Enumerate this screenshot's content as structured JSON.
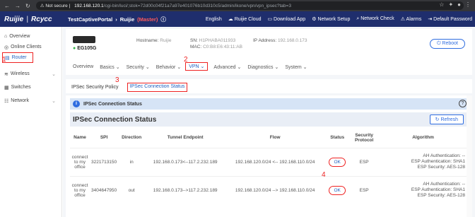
{
  "browser": {
    "not_secure": "Not secure",
    "host": "192.168.120.1",
    "path": "/cgi-bin/luci/;stok=72d00c04f21a7a97e401076b10d310c5/admin/ikone/vpn/vpn_ipsec?tab=3"
  },
  "header": {
    "logo_primary": "Ruijie",
    "logo_secondary": "Rcycc",
    "breadcrumb_portal": "TestCaptivePortal",
    "breadcrumb_device": "Ruijie",
    "breadcrumb_role": "(Master)",
    "links": [
      "English",
      "Ruijie Cloud",
      "Download App",
      "Network Setup",
      "Network Check",
      "Alarms",
      "Default Password"
    ]
  },
  "sidebar": {
    "items": [
      {
        "label": "Overview",
        "icon": "overview-icon"
      },
      {
        "label": "Online Clients",
        "icon": "clients-icon"
      },
      {
        "label": "Router",
        "icon": "router-icon"
      },
      {
        "label": "Wireless",
        "icon": "wifi-icon"
      },
      {
        "label": "Switches",
        "icon": "switch-icon"
      },
      {
        "label": "Network",
        "icon": "network-icon"
      }
    ]
  },
  "device": {
    "model": "EG105G",
    "hostname_label": "Hostname:",
    "hostname": "Ruijie",
    "sn_label": "SN:",
    "sn": "H1PHABA011933",
    "mac_label": "MAC:",
    "mac": "C0:B8:E6:43:11:AB",
    "ip_label": "IP Address:",
    "ip": "192.168.0.173",
    "reboot_label": "Reboot"
  },
  "menu": {
    "items": [
      "Overview",
      "Basics",
      "Security",
      "Behavior",
      "VPN",
      "Advanced",
      "Diagnostics",
      "System"
    ]
  },
  "subtabs": {
    "items": [
      "IPSec Security Policy",
      "IPSec Connection Status"
    ]
  },
  "content": {
    "banner_title": "IPSec Connection Status",
    "card_title": "IPSec Connection Status",
    "refresh_label": "Refresh"
  },
  "table": {
    "headers": [
      "Name",
      "SPI",
      "Direction",
      "Tunnel Endpoint",
      "Flow",
      "Status",
      "Security Protocol",
      "Algorithm"
    ],
    "rows": [
      {
        "name": "connect to my office",
        "spi": "3221713150",
        "direction": "in",
        "endpoint": "192.168.0.173<--117.2.232.189",
        "flow": "192.168.120.0/24 <-- 192.168.110.0/24",
        "status": "OK",
        "protocol": "ESP",
        "alg_ah": "AH Authentication: --",
        "alg_esp_auth": "ESP Authentication: SHA1",
        "alg_esp_sec": "ESP Security: AES-128"
      },
      {
        "name": "connect to my office",
        "spi": "3404647950",
        "direction": "out",
        "endpoint": "192.168.0.173-->117.2.232.189",
        "flow": "192.168.120.0/24 --> 192.168.110.0/24",
        "status": "OK",
        "protocol": "ESP",
        "alg_ah": "AH Authentication: --",
        "alg_esp_auth": "ESP Authentication: SHA1",
        "alg_esp_sec": "ESP Security: AES-128"
      }
    ]
  },
  "annotations": [
    "1",
    "2",
    "3",
    "4"
  ]
}
